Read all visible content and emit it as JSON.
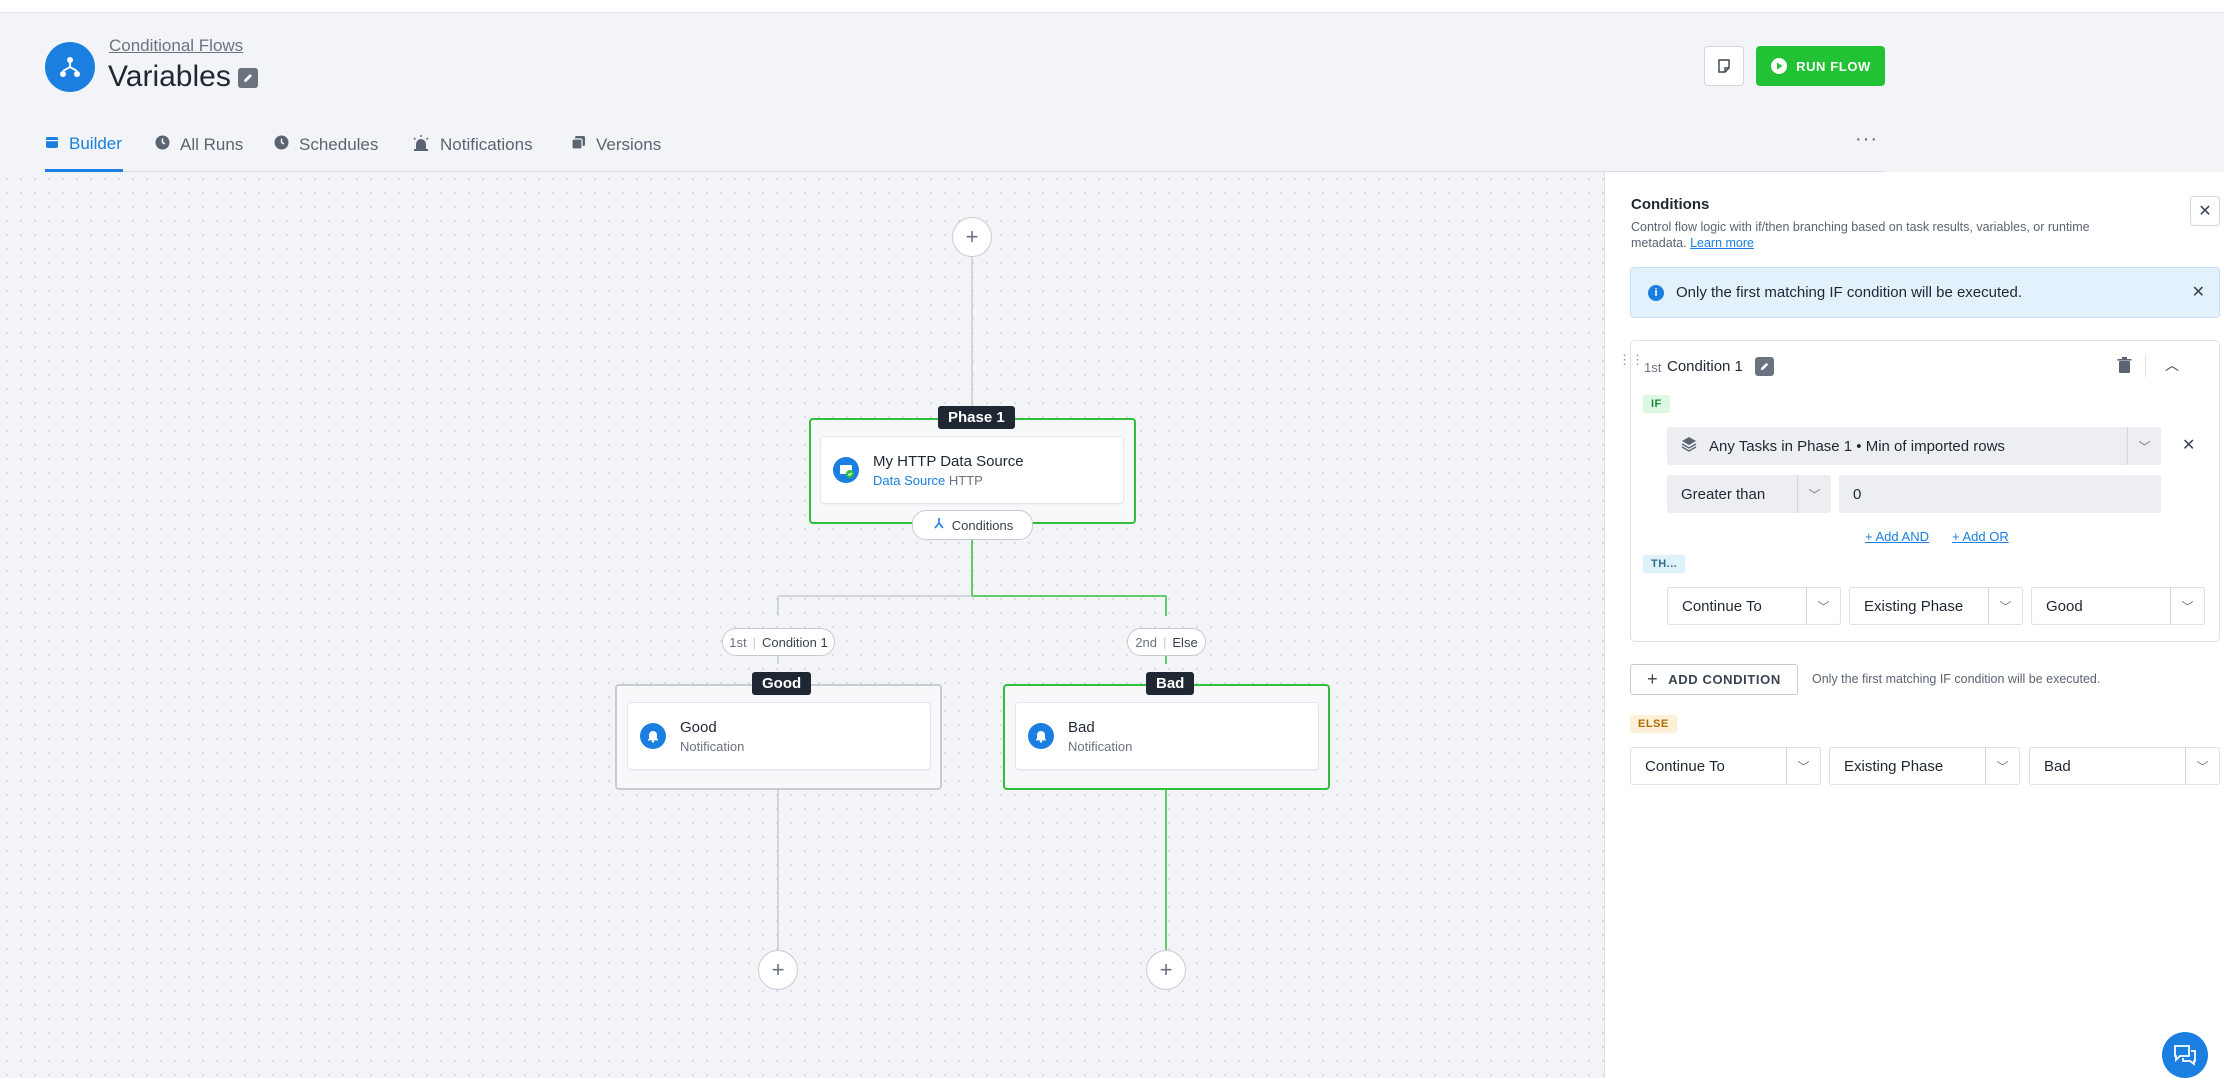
{
  "header": {
    "breadcrumb": "Conditional Flows",
    "title": "Variables",
    "run_label": "RUN FLOW"
  },
  "tabs": [
    {
      "label": "Builder",
      "icon": "calendar-icon",
      "active": true
    },
    {
      "label": "All Runs",
      "icon": "clock-icon",
      "active": false
    },
    {
      "label": "Schedules",
      "icon": "clock-icon",
      "active": false
    },
    {
      "label": "Notifications",
      "icon": "alarm-icon",
      "active": false
    },
    {
      "label": "Versions",
      "icon": "copy-icon",
      "active": false
    }
  ],
  "flow": {
    "phase1": {
      "label": "Phase 1",
      "task_title": "My HTTP Data Source",
      "task_type": "Data Source",
      "task_kind": "HTTP",
      "conditions_label": "Conditions"
    },
    "branch_left": {
      "order": "1st",
      "name": "Condition 1"
    },
    "branch_right": {
      "order": "2nd",
      "name": "Else"
    },
    "good": {
      "label": "Good",
      "task_title": "Good",
      "task_sub": "Notification"
    },
    "bad": {
      "label": "Bad",
      "task_title": "Bad",
      "task_sub": "Notification"
    }
  },
  "panel": {
    "title": "Conditions",
    "description": "Control flow logic with if/then branching based on task results, variables, or runtime metadata.",
    "learn_more": "Learn more",
    "info": "Only the first matching IF condition will be executed.",
    "condition": {
      "order": "1st",
      "name": "Condition 1",
      "if_label": "IF",
      "source": "Any Tasks in Phase 1 • Min of imported rows",
      "operator": "Greater than",
      "value": "0",
      "add_and": "Add AND",
      "add_or": "Add OR",
      "then_label": "TH...",
      "then_action": "Continue To",
      "then_target_type": "Existing Phase",
      "then_target": "Good"
    },
    "add_condition": "ADD CONDITION",
    "add_condition_note": "Only the first matching IF condition will be executed.",
    "else": {
      "label": "ELSE",
      "action": "Continue To",
      "target_type": "Existing Phase",
      "target": "Bad"
    }
  },
  "colors": {
    "accent": "#1a7fe0",
    "run": "#21c233",
    "active_path": "#2fbf3c"
  }
}
